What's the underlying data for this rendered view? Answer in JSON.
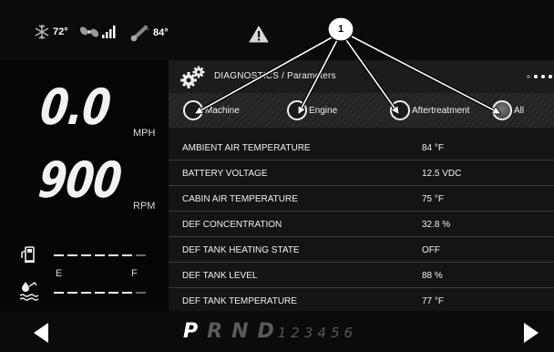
{
  "status": {
    "ambient_temp": "72°",
    "engine_temp": "84°"
  },
  "gauges": {
    "speed_value": "0.0",
    "speed_unit": "MPH",
    "rpm_value": "900",
    "rpm_unit": "RPM",
    "def_empty": "E",
    "def_full": "F"
  },
  "diagnostics": {
    "title": "DIAGNOSTICS / Parameters",
    "tabs": [
      {
        "label": "Machine",
        "selected": false
      },
      {
        "label": "Engine",
        "selected": false
      },
      {
        "label": "Aftertreatment",
        "selected": false
      },
      {
        "label": "All",
        "selected": true
      }
    ],
    "rows": [
      {
        "label": "AMBIENT AIR TEMPERATURE",
        "value": "84 °F"
      },
      {
        "label": "BATTERY VOLTAGE",
        "value": "12.5 VDC"
      },
      {
        "label": "CABIN AIR TEMPERATURE",
        "value": "75 °F"
      },
      {
        "label": "DEF CONCENTRATION",
        "value": "32.8 %"
      },
      {
        "label": "DEF TANK HEATING STATE",
        "value": "OFF"
      },
      {
        "label": "DEF TANK LEVEL",
        "value": "88 %"
      },
      {
        "label": "DEF TANK TEMPERATURE",
        "value": "77 °F"
      }
    ]
  },
  "callout": {
    "number": "1"
  },
  "transmission": {
    "gears": [
      "P",
      "R",
      "N",
      "D"
    ],
    "active_gear": "P",
    "manual_gears": "123456"
  },
  "icons": {
    "snowflake": "snowflake-icon",
    "fan": "fan-icon",
    "signal": "signal-bars-icon",
    "thermometer": "thermometer-icon",
    "warning": "warning-triangle-icon",
    "gears": "gears-icon",
    "fuel": "fuel-pump-icon",
    "def_tank": "def-tank-icon",
    "left_arrow": "left-arrow-icon",
    "right_arrow": "right-arrow-icon"
  }
}
